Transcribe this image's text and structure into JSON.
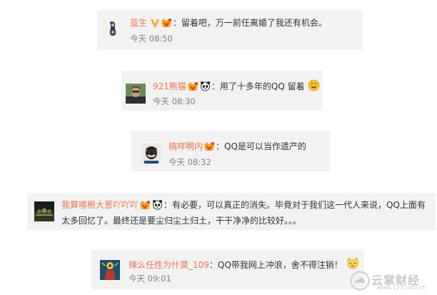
{
  "comments": [
    {
      "username": "蓝生",
      "avatar_icon": "blue-shoe-avatar",
      "badges": [
        "verified-v-icon",
        "vip-badge-icon"
      ],
      "text": "：留着吧，万一前任离婚了我还有机会。",
      "time": "今天 08:50"
    },
    {
      "username": "921熊猫",
      "avatar_icon": "person-photo-avatar",
      "badges": [
        "vip-badge-icon",
        "panda-icon"
      ],
      "text": "：用了十多年的QQ 留着",
      "emoji": "smile-emoji-icon",
      "time": "今天 08:30"
    },
    {
      "username": "搞咩啊内",
      "avatar_icon": "smiling-man-avatar",
      "badges": [
        "vip-badge-icon"
      ],
      "text": "：QQ是可以当作遗产的",
      "time": "今天 08:32"
    },
    {
      "username": "我算哪根大葱吖吖吖",
      "avatar_icon": "dark-landscape-avatar",
      "badges": [
        "vip-badge-icon",
        "panda-icon"
      ],
      "text_line1": "：有必要，可以真正的消失。毕竟对于我们这一代人来说，QQ上面有",
      "text_line2": "太多回忆了。最终还是要尘归尘土归土，干干净净的比较好。。。"
    },
    {
      "username": "辣么任性为什莫_109",
      "avatar_icon": "colorful-figure-avatar",
      "badges": [],
      "text": "：QQ带我网上冲浪，舍不得注销！",
      "emoji": "cat-emoji-icon",
      "time": "今天 09:01"
    }
  ],
  "watermark": {
    "name": "云掌财经",
    "url": "www.123.com.cn",
    "icon": "cloud-logo-icon"
  },
  "colors": {
    "card_bg": "#f2f2f2",
    "username": "#eb7350",
    "text": "#333333",
    "time": "#808080",
    "verified": "#f5a623"
  }
}
